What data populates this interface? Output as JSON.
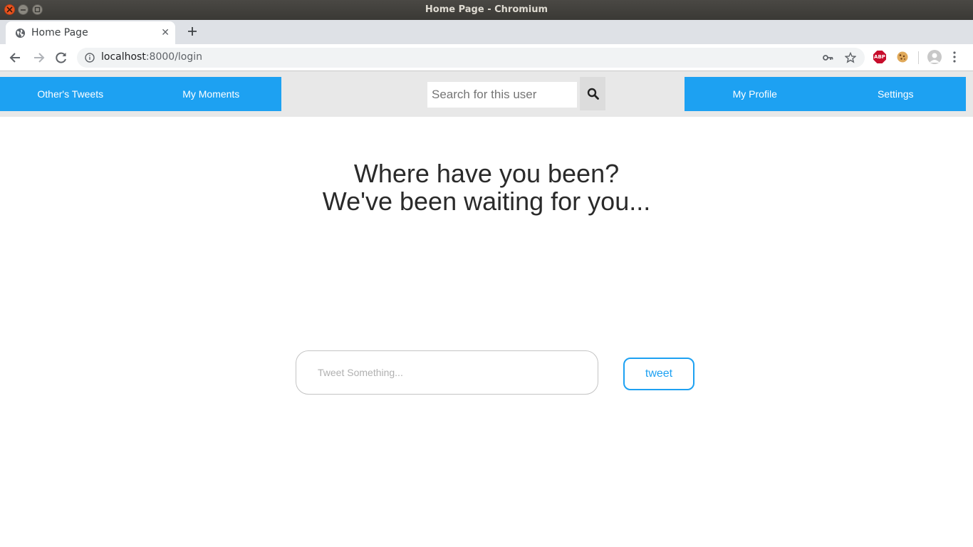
{
  "window": {
    "title": "Home Page - Chromium"
  },
  "tab": {
    "title": "Home Page",
    "close": "✕",
    "new_tab": "+"
  },
  "address_bar": {
    "host": "localhost",
    "rest": ":8000/login"
  },
  "extensions": {
    "abp_label": "ABP"
  },
  "nav": {
    "left": [
      "Other's Tweets",
      "My Moments"
    ],
    "right": [
      "My Profile",
      "Settings"
    ],
    "search_placeholder": "Search for this user"
  },
  "main": {
    "headline_line1": "Where have you been?",
    "headline_line2": "We've been waiting for you...",
    "tweet_placeholder": "Tweet Something...",
    "tweet_button": "tweet"
  },
  "colors": {
    "brand": "#1da1f2",
    "navbar_bg": "#e8e8e8"
  }
}
